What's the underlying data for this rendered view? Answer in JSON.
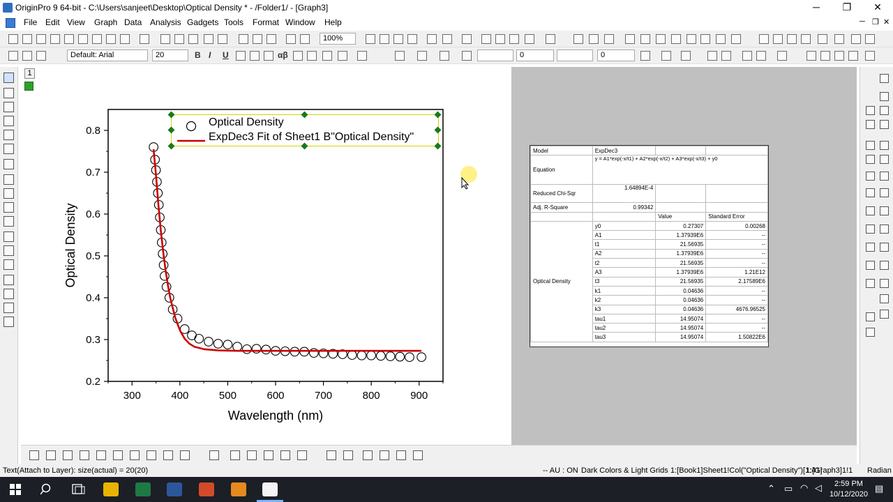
{
  "window": {
    "title": "OriginPro 9 64-bit - C:\\Users\\sanjeet\\Desktop\\Optical Density * - /Folder1/ - [Graph3]",
    "minimize": "─",
    "restore": "❐",
    "close": "✕"
  },
  "menu": {
    "items": [
      "File",
      "Edit",
      "View",
      "Graph",
      "Data",
      "Analysis",
      "Gadgets",
      "Tools",
      "Format",
      "Window",
      "Help"
    ]
  },
  "toolbar": {
    "zoom": "100%",
    "font": "Default: Arial",
    "font_size": "20",
    "bold": "B",
    "italic": "I",
    "underline": "U",
    "greek": "αβ",
    "line_width": "0",
    "angle": "0"
  },
  "layer": {
    "number": "1"
  },
  "graph": {
    "xlabel": "Wavelength (nm)",
    "ylabel": "Optical Density",
    "legend": [
      "Optical Density",
      "ExpDec3 Fit of Sheet1 B\"Optical Density\""
    ],
    "colors": {
      "fit": "#cc0000",
      "symbol": "#000000",
      "legend_frame": "#cccc00",
      "handle": "#1a7a1a"
    }
  },
  "chart_data": {
    "type": "scatter",
    "xlabel": "Wavelength (nm)",
    "ylabel": "Optical Density",
    "xlim": [
      250,
      950
    ],
    "ylim": [
      0.2,
      0.85
    ],
    "xticks": [
      300,
      400,
      500,
      600,
      700,
      800,
      900
    ],
    "yticks": [
      0.2,
      0.3,
      0.4,
      0.5,
      0.6,
      0.7,
      0.8
    ],
    "legend_position": "top-right",
    "series": [
      {
        "name": "Optical Density",
        "marker": "open-circle",
        "x": [
          345,
          348,
          350,
          352,
          354,
          356,
          358,
          360,
          362,
          364,
          366,
          368,
          372,
          378,
          385,
          395,
          410,
          425,
          440,
          460,
          480,
          500,
          520,
          540,
          560,
          580,
          600,
          620,
          640,
          660,
          680,
          700,
          720,
          740,
          760,
          780,
          800,
          820,
          840,
          860,
          880,
          905
        ],
        "y": [
          0.76,
          0.73,
          0.705,
          0.677,
          0.65,
          0.622,
          0.592,
          0.562,
          0.532,
          0.505,
          0.478,
          0.452,
          0.426,
          0.4,
          0.372,
          0.35,
          0.325,
          0.31,
          0.302,
          0.295,
          0.29,
          0.288,
          0.283,
          0.277,
          0.278,
          0.276,
          0.273,
          0.272,
          0.271,
          0.271,
          0.268,
          0.267,
          0.266,
          0.265,
          0.263,
          0.262,
          0.262,
          0.261,
          0.26,
          0.259,
          0.258,
          0.258
        ]
      },
      {
        "name": "ExpDec3 Fit of Sheet1 B\"Optical Density\"",
        "line": true,
        "x": [
          345,
          350,
          355,
          360,
          365,
          370,
          375,
          380,
          390,
          400,
          410,
          420,
          430,
          450,
          480,
          520,
          600,
          700,
          800,
          905
        ],
        "y": [
          0.755,
          0.693,
          0.623,
          0.562,
          0.51,
          0.466,
          0.43,
          0.399,
          0.353,
          0.322,
          0.302,
          0.29,
          0.283,
          0.277,
          0.274,
          0.273,
          0.273,
          0.273,
          0.273,
          0.273
        ]
      }
    ]
  },
  "fit_table": {
    "model_label": "Model",
    "model_value": "ExpDec3",
    "equation_label": "Equation",
    "equation_value": "y = A1*exp(-x/t1) + A2*exp(-x/t2) + A3*exp(-x/t3) + y0",
    "chisqr_label": "Reduced Chi-Sqr",
    "chisqr_value": "1.64894E-4",
    "rsq_label": "Adj. R-Square",
    "rsq_value": "0.99342",
    "value_header": "Value",
    "se_header": "Standard Error",
    "group_label": "Optical Density",
    "params": [
      {
        "name": "y0",
        "value": "0.27307",
        "se": "0.00268"
      },
      {
        "name": "A1",
        "value": "1.37939E6",
        "se": "--"
      },
      {
        "name": "t1",
        "value": "21.56935",
        "se": "--"
      },
      {
        "name": "A2",
        "value": "1.37939E6",
        "se": "--"
      },
      {
        "name": "t2",
        "value": "21.56935",
        "se": "--"
      },
      {
        "name": "A3",
        "value": "1.37939E6",
        "se": "1.21E12"
      },
      {
        "name": "t3",
        "value": "21.56935",
        "se": "2.17589E6"
      },
      {
        "name": "k1",
        "value": "0.04636",
        "se": "--"
      },
      {
        "name": "k2",
        "value": "0.04636",
        "se": "--"
      },
      {
        "name": "k3",
        "value": "0.04636",
        "se": "4676.96525"
      },
      {
        "name": "tau1",
        "value": "14.95074",
        "se": "--"
      },
      {
        "name": "tau2",
        "value": "14.95074",
        "se": "--"
      },
      {
        "name": "tau3",
        "value": "14.95074",
        "se": "1.50822E6"
      }
    ]
  },
  "status": {
    "left": "Text(Attach to Layer): size(actual) = 20(20)",
    "au": "-- AU : ON",
    "theme": "Dark Colors & Light Grids",
    "col": "1:[Book1]Sheet1!Col(\"Optical Density\")[1:41]",
    "graph": "1:[Graph3]1!1",
    "units": "Radian"
  },
  "taskbar": {
    "time": "2:59 PM",
    "date": "10/12/2020"
  }
}
